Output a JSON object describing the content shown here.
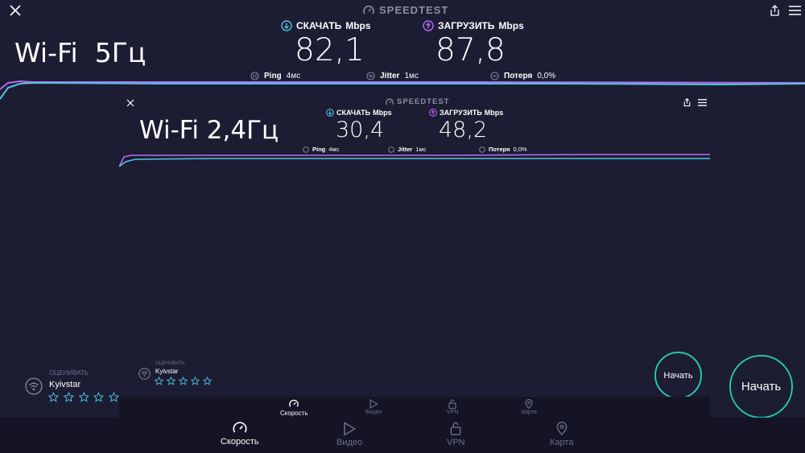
{
  "colors": {
    "background": "#1c1c32",
    "download_accent": "#52c3e0",
    "upload_accent": "#b36cf5",
    "start_ring": "#26c6ab",
    "nav_bg": "#141425",
    "muted": "#8a8ea6"
  },
  "outer": {
    "brand": "SPEEDTEST",
    "title": "Wi-Fi  5Гц",
    "download": {
      "label": "СКАЧАТЬ",
      "unit": "Mbps",
      "value": "82,1"
    },
    "upload": {
      "label": "ЗАГРУЗИТЬ",
      "unit": "Mbps",
      "value": "87,8"
    },
    "ping": {
      "label": "Ping",
      "value": "4мс"
    },
    "jitter": {
      "label": "Jitter",
      "value": "1мс"
    },
    "loss": {
      "label": "Потеря",
      "value": "0,0%"
    },
    "rate_label": "ОЦЕНИВАТЬ",
    "provider": "Kyivstar",
    "start_label": "Начать",
    "nav": {
      "speed": "Скорость",
      "video": "Видео",
      "vpn": "VPN",
      "map": "Карта"
    }
  },
  "inner": {
    "brand": "SPEEDTEST",
    "title": "Wi-Fi 2,4Гц",
    "download": {
      "label": "СКАЧАТЬ",
      "unit": "Mbps",
      "value": "30,4"
    },
    "upload": {
      "label": "ЗАГРУЗИТЬ",
      "unit": "Mbps",
      "value": "48,2"
    },
    "ping": {
      "label": "Ping",
      "value": "4мс"
    },
    "jitter": {
      "label": "Jitter",
      "value": "1мс"
    },
    "loss": {
      "label": "Потеря",
      "value": "0,0%"
    },
    "rate_label": "ОЦЕНИВАТЬ",
    "provider": "Kyivstar",
    "start_label": "Начать",
    "nav": {
      "speed": "Скорость",
      "video": "Видео",
      "vpn": "VPN",
      "map": "Карта"
    }
  },
  "icons": {
    "close": "close-icon",
    "share": "share-icon",
    "menu": "menu-icon",
    "speedometer": "speedometer-icon",
    "download": "download-arrow-icon",
    "upload": "upload-arrow-icon",
    "wifi": "wifi-icon",
    "star": "star-icon",
    "play": "play-icon",
    "lock": "lock-icon",
    "pin": "map-pin-icon"
  }
}
